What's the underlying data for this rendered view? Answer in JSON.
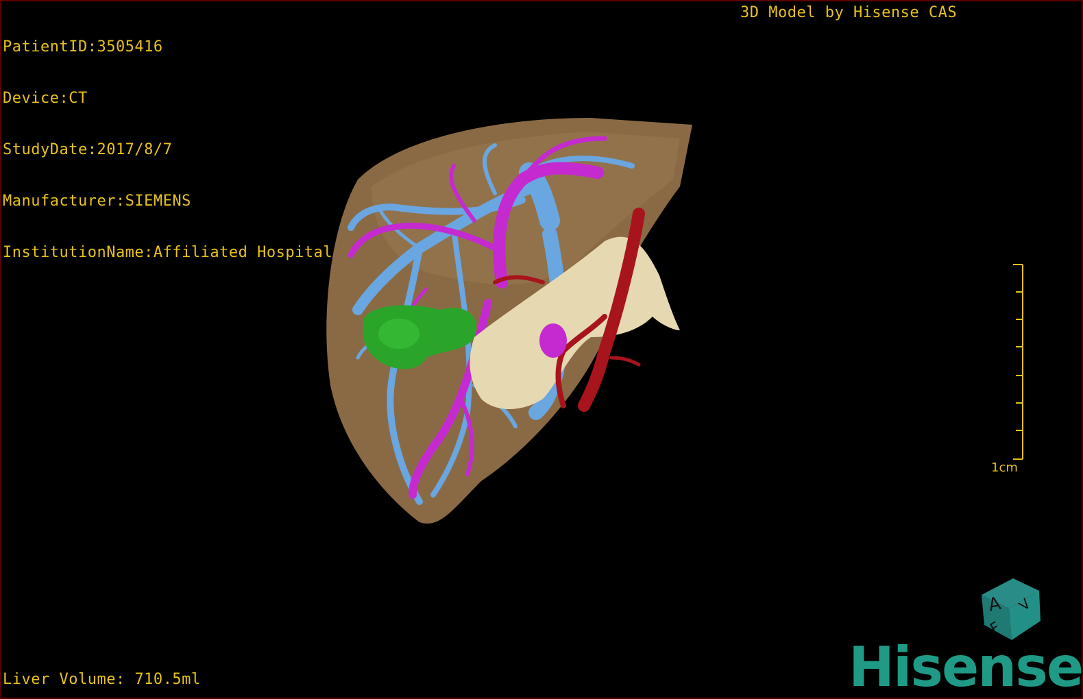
{
  "overlay": {
    "patient_id": "PatientID:3505416",
    "device": "Device:CT",
    "study_date": "StudyDate:2017/8/7",
    "manufacturer": "Manufacturer:SIEMENS",
    "institution": "InstitutionName:Affiliated Hospital Qingdao University-C",
    "brand_line": "3D Model by Hisense CAS",
    "liver_volume": "Liver Volume: 710.5ml"
  },
  "scale": {
    "label": "1cm"
  },
  "orientation_cube": {
    "face_front": "A",
    "face_bottom": "F",
    "face_side": "V"
  },
  "logo": {
    "text": "Hisense"
  },
  "colors": {
    "overlay_text": "#e8c21a",
    "liver": "#8a6a45",
    "portal_vein": "#6aa6e0",
    "hepatic_vein": "#c42ad0",
    "artery": "#a8141c",
    "tumor": "#2aa52a",
    "pancreas": "#e6d8b0",
    "logo": "#1f9a86"
  }
}
